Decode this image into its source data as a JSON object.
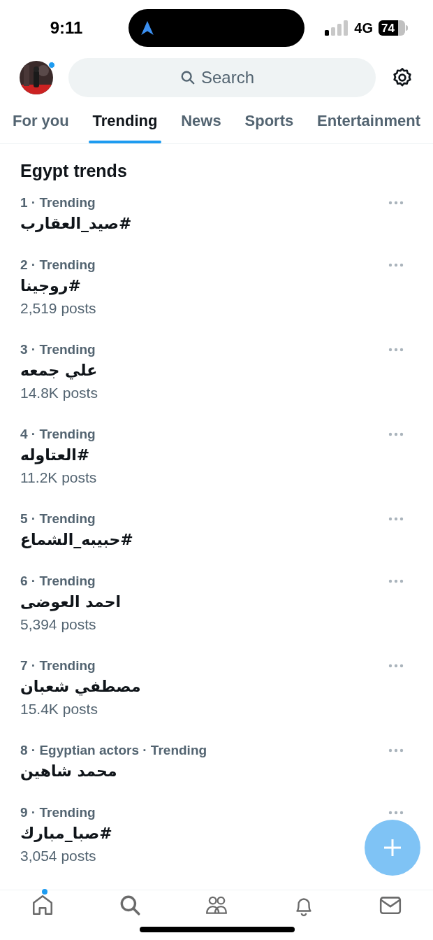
{
  "status_bar": {
    "time": "9:11",
    "network": "4G",
    "battery": "74"
  },
  "header": {
    "avatar_badge": true,
    "search": {
      "placeholder": "Search"
    }
  },
  "tabs": [
    {
      "label": "For you",
      "selected": false
    },
    {
      "label": "Trending",
      "selected": true
    },
    {
      "label": "News",
      "selected": false
    },
    {
      "label": "Sports",
      "selected": false
    },
    {
      "label": "Entertainment",
      "selected": false
    }
  ],
  "section_title": "Egypt trends",
  "trends": [
    {
      "meta": "1 · Trending",
      "title": "#صيد_العقارب"
    },
    {
      "meta": "2 · Trending",
      "title": "#روجينا",
      "posts": "2,519 posts"
    },
    {
      "meta": "3 · Trending",
      "title": "علي جمعه",
      "posts": "14.8K posts"
    },
    {
      "meta": "4 · Trending",
      "title": "#العتاوله",
      "posts": "11.2K posts"
    },
    {
      "meta": "5 · Trending",
      "title": "#حبيبه_الشماع"
    },
    {
      "meta": "6 · Trending",
      "title": "احمد العوضى",
      "posts": "5,394 posts"
    },
    {
      "meta": "7 · Trending",
      "title": "مصطفي شعبان",
      "posts": "15.4K posts"
    },
    {
      "meta": "8 · Egyptian actors · Trending",
      "title": "محمد شاهين"
    },
    {
      "meta": "9 · Trending",
      "title": "#صبا_مبارك",
      "posts": "3,054 posts"
    }
  ],
  "fab": {
    "kind": "compose"
  },
  "nav": [
    {
      "kind": "home",
      "badge": true
    },
    {
      "kind": "search",
      "badge": false
    },
    {
      "kind": "people",
      "badge": false
    },
    {
      "kind": "bell",
      "badge": false
    },
    {
      "kind": "mail",
      "badge": false
    }
  ]
}
